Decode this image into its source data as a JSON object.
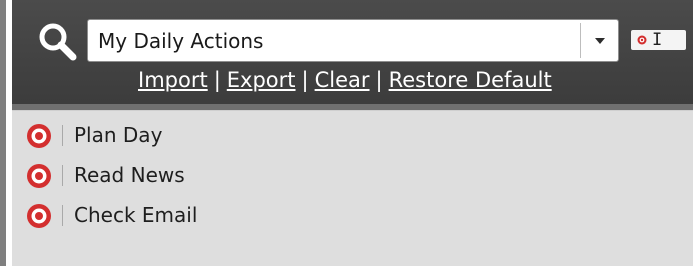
{
  "search": {
    "icon": "search-icon",
    "selected_list": "My Daily Actions",
    "dropdown_icon": "chevron-down-icon"
  },
  "mini_widget": {
    "icon": "target-icon",
    "cursor_glyph": "I"
  },
  "links": {
    "import": "Import",
    "export": "Export",
    "clear": "Clear",
    "restore_default": "Restore Default",
    "separator": "|"
  },
  "items": [
    {
      "label": "Plan Day",
      "icon": "target-icon"
    },
    {
      "label": "Read News",
      "icon": "target-icon"
    },
    {
      "label": "Check Email",
      "icon": "target-icon"
    }
  ],
  "colors": {
    "header_bg": "#454545",
    "list_bg": "#dedede",
    "target_red": "#d32f2f",
    "link_text": "#ffffff"
  }
}
